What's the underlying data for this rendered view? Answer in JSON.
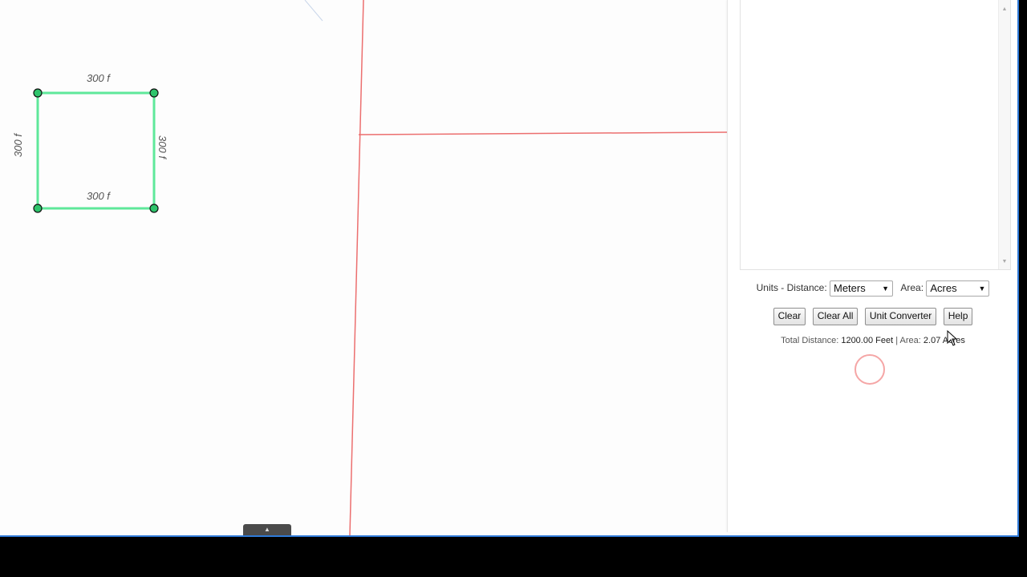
{
  "map": {
    "measure_labels": {
      "top": "300 f",
      "bottom": "300 f",
      "left": "300 f",
      "right": "300 f"
    },
    "shape_color": "#5ee89a",
    "parcel_line_color": "#ec6f6f",
    "vertex_icon": "circle-vertex-icon"
  },
  "measure_panel": {
    "units_label": "Units - Distance:",
    "distance_unit": "Meters",
    "area_label": "Area:",
    "area_unit": "Acres",
    "buttons": {
      "clear": "Clear",
      "clear_all": "Clear All",
      "unit_converter": "Unit Converter",
      "help": "Help"
    },
    "totals": {
      "distance_label": "Total Distance:",
      "distance_value": "1200.00 Feet",
      "separator": "|",
      "area_label": "Area:",
      "area_value": "2.07 Acres"
    }
  },
  "icons": {
    "scroll_up": "▲",
    "scroll_down": "▼",
    "dropdown_caret": "▼",
    "expand_arrow": "▲"
  }
}
